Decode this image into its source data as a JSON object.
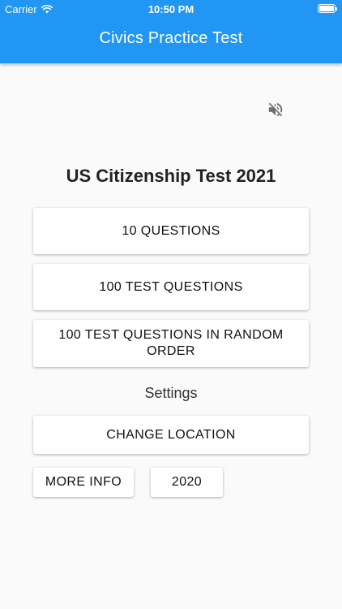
{
  "status_bar": {
    "carrier": "Carrier",
    "time": "10:50 PM",
    "icons": [
      "wifi-icon",
      "battery-icon"
    ]
  },
  "app_bar": {
    "title": "Civics Practice Test",
    "color": "#2196f3"
  },
  "sound": {
    "icon": "volume-off-icon"
  },
  "main": {
    "title": "US Citizenship Test 2021",
    "buttons": [
      {
        "label": "10 QUESTIONS"
      },
      {
        "label": "100 TEST QUESTIONS"
      },
      {
        "label": "100 TEST QUESTIONS IN RANDOM ORDER"
      }
    ],
    "settings_label": "Settings",
    "change_location": "CHANGE LOCATION",
    "more_info": "MORE INFO",
    "year": "2020"
  }
}
